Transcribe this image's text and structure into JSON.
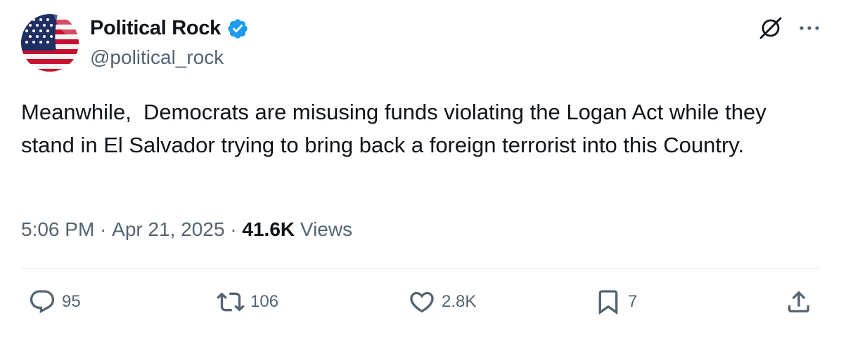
{
  "author": {
    "name": "Political Rock",
    "handle": "@political_rock",
    "verified": true,
    "avatar_icon": "us-flag-avatar"
  },
  "header_actions": [
    {
      "icon": "grok-icon"
    },
    {
      "icon": "more-icon"
    }
  ],
  "tweet": {
    "text": "Meanwhile,  Democrats are misusing funds violating the Logan Act while they stand in El Salvador trying to bring back a foreign terrorist into this Country."
  },
  "meta": {
    "time": "5:06 PM",
    "separator": " · ",
    "date": "Apr 21, 2025",
    "views_count": "41.6K",
    "views_label": " Views"
  },
  "actions": {
    "reply": {
      "icon": "reply-icon",
      "count": "95"
    },
    "retweet": {
      "icon": "retweet-icon",
      "count": "106"
    },
    "like": {
      "icon": "heart-icon",
      "count": "2.8K"
    },
    "bookmark": {
      "icon": "bookmark-icon",
      "count": "7"
    },
    "share": {
      "icon": "share-icon"
    }
  },
  "colors": {
    "text_primary": "#0f1419",
    "text_secondary": "#536471",
    "verified_blue": "#1d9bf0",
    "divider": "#eff3f4"
  }
}
